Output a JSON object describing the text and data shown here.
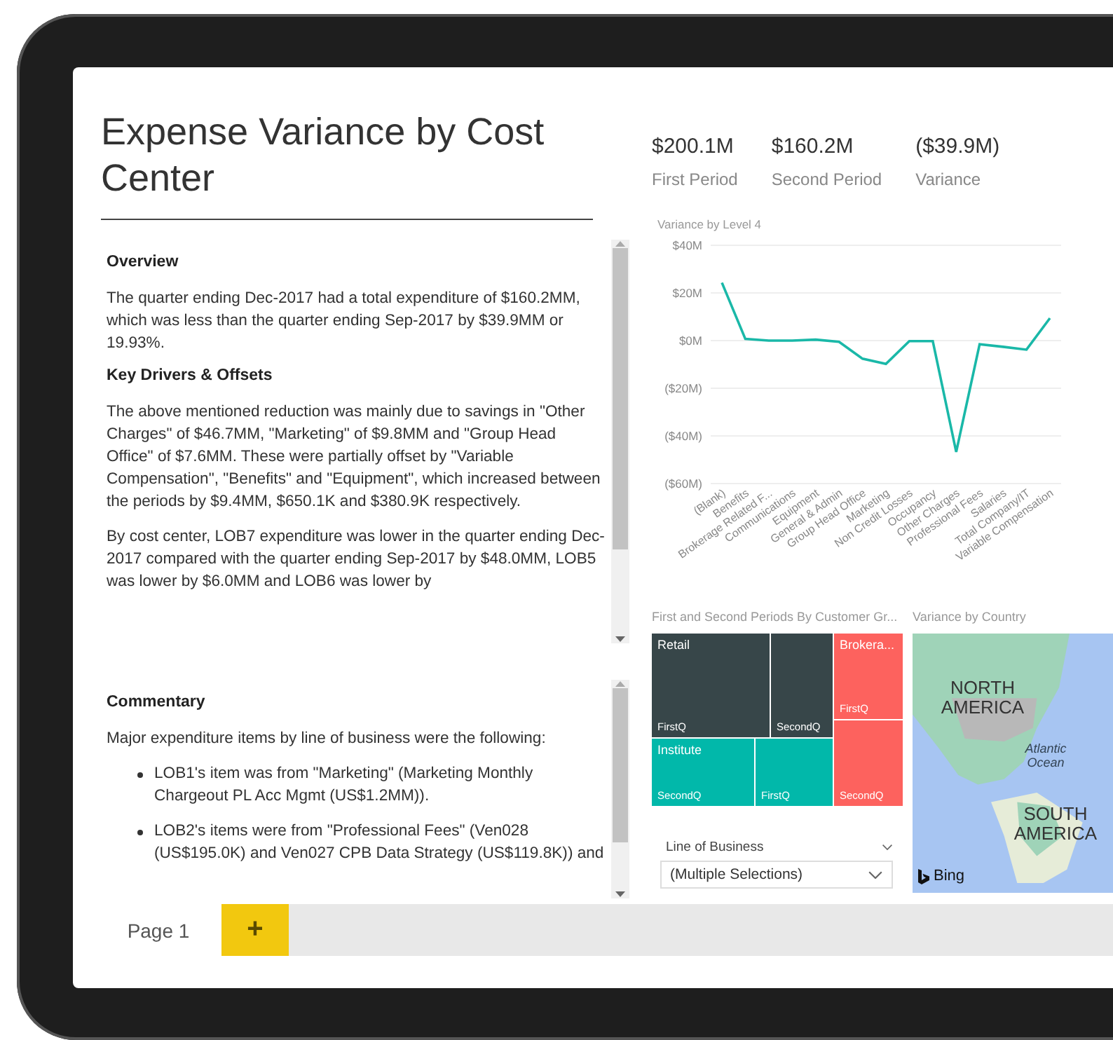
{
  "report": {
    "title": "Expense Variance by Cost Center"
  },
  "kpis": [
    {
      "value": "$200.1M",
      "label": "First Period"
    },
    {
      "value": "$160.2M",
      "label": "Second Period"
    },
    {
      "value": "($39.9M)",
      "label": "Variance"
    }
  ],
  "narrative": [
    {
      "kind": "heading",
      "text": "Overview"
    },
    {
      "kind": "paragraph",
      "text": "The quarter ending Dec-2017 had a total expenditure of $160.2MM, which was less than the quarter ending Sep-2017 by $39.9MM or 19.93%."
    },
    {
      "kind": "heading",
      "text": "Key Drivers & Offsets"
    },
    {
      "kind": "paragraph",
      "text": "The above mentioned reduction was mainly due to savings in \"Other Charges\" of $46.7MM, \"Marketing\" of $9.8MM and \"Group Head Office\" of $7.6MM. These were partially offset by \"Variable Compensation\", \"Benefits\" and \"Equipment\", which increased between the periods by $9.4MM, $650.1K and $380.9K respectively."
    },
    {
      "kind": "paragraph",
      "text": "By cost center, LOB7 expenditure was lower in the quarter ending Dec-2017 compared with the quarter ending Sep-2017 by $48.0MM, LOB5 was lower by $6.0MM and LOB6 was lower by"
    }
  ],
  "commentary": [
    {
      "kind": "heading",
      "text": "Commentary"
    },
    {
      "kind": "paragraph",
      "text": "Major expenditure items by line of business were the following:"
    },
    {
      "kind": "bullet",
      "text": "LOB1's item was from \"Marketing\" (Marketing Monthly Chargeout PL Acc Mgmt (US$1.2MM))."
    },
    {
      "kind": "bullet",
      "text": "LOB2's items were from \"Professional Fees\" (Ven028 (US$195.0K) and Ven027 CPB Data Strategy (US$119.8K)) and"
    }
  ],
  "line_chart": {
    "chart_data": {
      "type": "line",
      "title": "Variance by Level 4",
      "categories": [
        "(Blank)",
        "Benefits",
        "Brokerage Related F...",
        "Communications",
        "Equipment",
        "General & Admin",
        "Group Head Office",
        "Marketing",
        "Non Credit Losses",
        "Occupancy",
        "Other Charges",
        "Professional Fees",
        "Salaries",
        "Total Company/IT",
        "Variable Compensation"
      ],
      "grid": true,
      "series": [
        {
          "color": "#1ab8a8",
          "values": [
            24.3,
            0.7,
            0,
            0,
            0.4,
            -0.5,
            -7.6,
            -9.8,
            -0.2,
            -0.2,
            -46.7,
            -1.5,
            -2.6,
            -3.8,
            9.4
          ]
        }
      ],
      "ylim": [
        -60,
        40
      ],
      "yticks": [
        {
          "value": 40,
          "label": "$40M"
        },
        {
          "value": 20,
          "label": "$20M"
        },
        {
          "value": 0,
          "label": "$0M"
        },
        {
          "value": -20,
          "label": "($20M)"
        },
        {
          "value": -40,
          "label": "($40M)"
        },
        {
          "value": -60,
          "label": "($60M)"
        }
      ]
    }
  },
  "treemap": {
    "title": "First and Second Periods By Customer Gr...",
    "groups": [
      {
        "label": "Retail",
        "color": "#374649",
        "cells": [
          "FirstQ",
          "SecondQ"
        ]
      },
      {
        "label": "Institute",
        "color": "#01b8aa",
        "cells": [
          "SecondQ",
          "FirstQ"
        ]
      },
      {
        "label": "Brokera...",
        "color": "#fd625e",
        "cells": [
          "FirstQ",
          "SecondQ"
        ]
      }
    ]
  },
  "slicer": {
    "title": "Line of Business",
    "value": "(Multiple Selections)"
  },
  "map": {
    "title": "Variance by Country",
    "labels": [
      {
        "kind": "continent",
        "text": "NORTH AMERICA"
      },
      {
        "kind": "ocean",
        "text": "Atlantic Ocean"
      },
      {
        "kind": "continent",
        "text": "SOUTH AMERICA"
      }
    ],
    "attribution": "Bing"
  },
  "pages": [
    {
      "label": "Page 1",
      "selected": true
    }
  ],
  "add_page": {
    "label": "+"
  }
}
